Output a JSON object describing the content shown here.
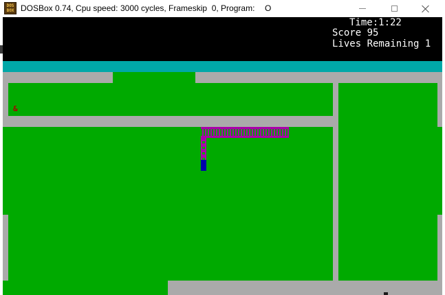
{
  "window": {
    "title_app": "DOSBox 0.74, Cpu speed:",
    "title_cycles": "3000 cycles, Frameskip  0, Program:",
    "title_program": "O",
    "icon_line1": "DOS",
    "icon_line2": "BOX"
  },
  "hud": {
    "time": "Time:1:22",
    "score": "Score 95",
    "lives": "Lives Remaining 1"
  },
  "game": {
    "food_glyph": "&",
    "colors": {
      "grass": "#00aa00",
      "wall": "#aaaaaa",
      "banner": "#00a8a8",
      "snake_body": "#aa00aa",
      "snake_head": "#0000aa",
      "food": "#aa0000"
    }
  }
}
